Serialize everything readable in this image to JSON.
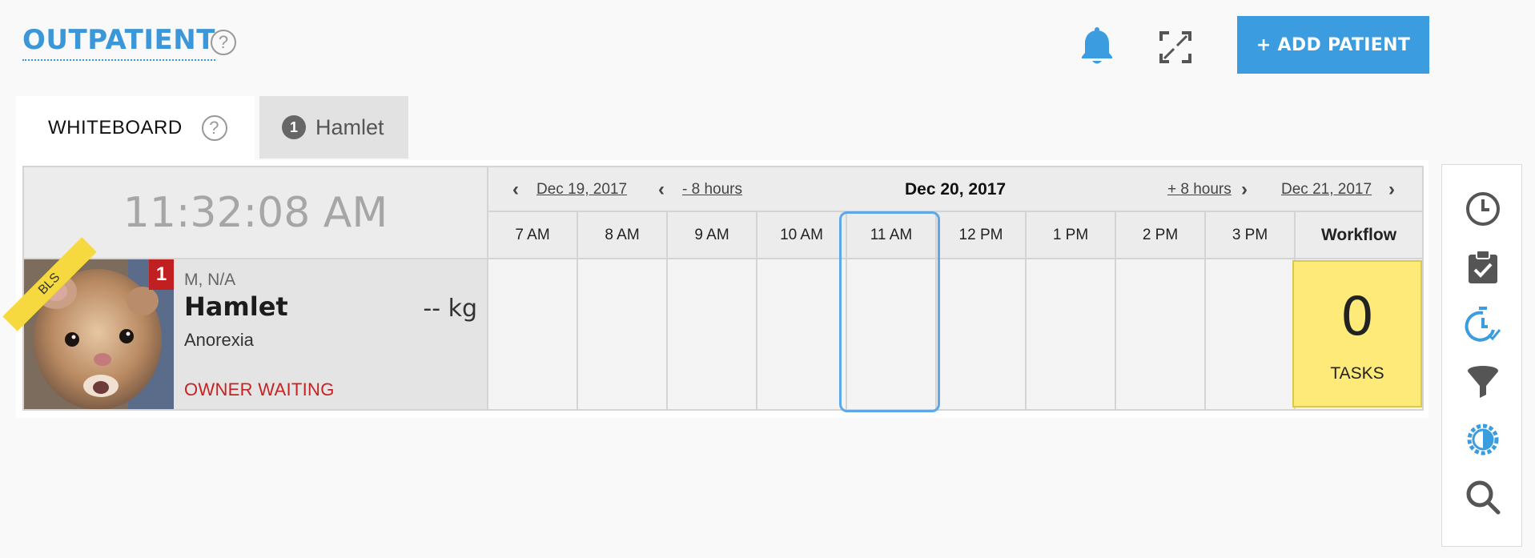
{
  "header": {
    "title": "OUTPATIENT",
    "help_symbol": "?",
    "add_patient_label": "+ ADD PATIENT",
    "icons": [
      "bell-icon",
      "expand-icon"
    ]
  },
  "tabs": [
    {
      "label": "WHITEBOARD",
      "help_symbol": "?"
    },
    {
      "badge": "1",
      "label": "Hamlet"
    }
  ],
  "board": {
    "current_time": "11:32:08 AM",
    "nav": {
      "prev_day": "Dec 19, 2017",
      "minus_hours": "- 8 hours",
      "current_date": "Dec 20, 2017",
      "plus_hours": "+ 8 hours",
      "next_day": "Dec 21, 2017"
    },
    "hours": [
      "7 AM",
      "8 AM",
      "9 AM",
      "10 AM",
      "11 AM",
      "12 PM",
      "1 PM",
      "2 PM",
      "3 PM"
    ],
    "current_hour": "11 AM",
    "workflow_header": "Workflow"
  },
  "patient": {
    "tag": "BLS",
    "alert_count": "1",
    "sex_age": "M, N/A",
    "name": "Hamlet",
    "weight": "-- kg",
    "condition": "Anorexia",
    "status": "OWNER WAITING",
    "status_color": "#c62222"
  },
  "workflow": {
    "count": "0",
    "label": "TASKS",
    "color": "#fdea78"
  },
  "toolbar": {
    "icons": [
      "clock-icon",
      "clipboard-check-icon",
      "timer-check-icon",
      "filter-icon",
      "contrast-gear-icon",
      "search-icon"
    ]
  },
  "colors": {
    "accent": "#3c9ce0",
    "alert": "#c0201f",
    "tag": "#f5d93e"
  }
}
